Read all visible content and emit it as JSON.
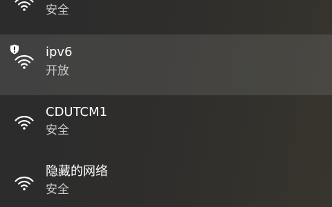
{
  "networks": [
    {
      "name": "",
      "status": "安全",
      "icon": "wifi-icon",
      "selected": false
    },
    {
      "name": "ipv6",
      "status": "开放",
      "icon": "wifi-open-warning-icon",
      "selected": true
    },
    {
      "name": "CDUTCM1",
      "status": "安全",
      "icon": "wifi-icon",
      "selected": false
    },
    {
      "name": "隐藏的网络",
      "status": "安全",
      "icon": "wifi-icon",
      "selected": false
    }
  ],
  "colors": {
    "selected_background": "#3b3b3a",
    "primary_text": "#ffffff",
    "secondary_text": "#c8c8c8"
  }
}
